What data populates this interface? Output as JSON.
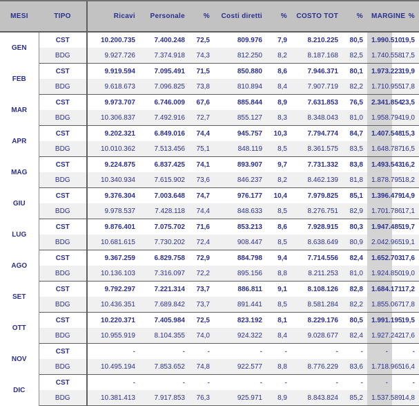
{
  "table": {
    "columns": [
      {
        "key": "mesi",
        "label": "MESI",
        "align": "center"
      },
      {
        "key": "tipo",
        "label": "TIPO",
        "align": "center"
      },
      {
        "key": "ricavi",
        "label": "Ricavi",
        "align": "right"
      },
      {
        "key": "personale",
        "label": "Personale",
        "align": "right"
      },
      {
        "key": "pct_pers",
        "label": "%",
        "align": "right"
      },
      {
        "key": "costi",
        "label": "Costi diretti",
        "align": "right"
      },
      {
        "key": "pct_costi",
        "label": "%",
        "align": "right"
      },
      {
        "key": "costotot",
        "label": "COSTO TOT",
        "align": "right"
      },
      {
        "key": "pct_tot",
        "label": "%",
        "align": "right"
      },
      {
        "key": "margine",
        "label": "MARGINE",
        "align": "right"
      },
      {
        "key": "pct_marg",
        "label": "%",
        "align": "right"
      }
    ],
    "colors": {
      "header_bg": "#c2c2c2",
      "header_text": "#2b2f8f",
      "body_text": "#2b2f8f",
      "row_cst_bg": "#ffffff",
      "row_bdg_bg": "#f0f0f0",
      "margine_highlight_bg": "#d4d4d4",
      "border_strong": "#5e5e5e",
      "border_light": "#8a8a8a"
    },
    "tipo_labels": {
      "cst": "CST",
      "bdg": "BDG"
    },
    "empty_value": "-",
    "months": [
      {
        "name": "GEN",
        "cst": {
          "tipo": "CST",
          "ricavi": "10.200.735",
          "personale": "7.400.248",
          "pct_pers": "72,5",
          "costi": "809.976",
          "pct_costi": "7,9",
          "costotot": "8.210.225",
          "pct_tot": "80,5",
          "margine": "1.990.510",
          "pct_marg": "19,5"
        },
        "bdg": {
          "tipo": "BDG",
          "ricavi": "9.927.726",
          "personale": "7.374.918",
          "pct_pers": "74,3",
          "costi": "812.250",
          "pct_costi": "8,2",
          "costotot": "8.187.168",
          "pct_tot": "82,5",
          "margine": "1.740.558",
          "pct_marg": "17,5"
        }
      },
      {
        "name": "FEB",
        "cst": {
          "tipo": "CST",
          "ricavi": "9.919.594",
          "personale": "7.095.491",
          "pct_pers": "71,5",
          "costi": "850.880",
          "pct_costi": "8,6",
          "costotot": "7.946.371",
          "pct_tot": "80,1",
          "margine": "1.973.223",
          "pct_marg": "19,9"
        },
        "bdg": {
          "tipo": "BDG",
          "ricavi": "9.618.673",
          "personale": "7.096.825",
          "pct_pers": "73,8",
          "costi": "810.894",
          "pct_costi": "8,4",
          "costotot": "7.907.719",
          "pct_tot": "82,2",
          "margine": "1.710.955",
          "pct_marg": "17,8"
        }
      },
      {
        "name": "MAR",
        "cst": {
          "tipo": "CST",
          "ricavi": "9.973.707",
          "personale": "6.746.009",
          "pct_pers": "67,6",
          "costi": "885.844",
          "pct_costi": "8,9",
          "costotot": "7.631.853",
          "pct_tot": "76,5",
          "margine": "2.341.854",
          "pct_marg": "23,5"
        },
        "bdg": {
          "tipo": "BDG",
          "ricavi": "10.306.837",
          "personale": "7.492.916",
          "pct_pers": "72,7",
          "costi": "855.127",
          "pct_costi": "8,3",
          "costotot": "8.348.043",
          "pct_tot": "81,0",
          "margine": "1.958.794",
          "pct_marg": "19,0"
        }
      },
      {
        "name": "APR",
        "cst": {
          "tipo": "CST",
          "ricavi": "9.202.321",
          "personale": "6.849.016",
          "pct_pers": "74,4",
          "costi": "945.757",
          "pct_costi": "10,3",
          "costotot": "7.794.774",
          "pct_tot": "84,7",
          "margine": "1.407.548",
          "pct_marg": "15,3"
        },
        "bdg": {
          "tipo": "BDG",
          "ricavi": "10.010.362",
          "personale": "7.513.456",
          "pct_pers": "75,1",
          "costi": "848.119",
          "pct_costi": "8,5",
          "costotot": "8.361.575",
          "pct_tot": "83,5",
          "margine": "1.648.787",
          "pct_marg": "16,5"
        }
      },
      {
        "name": "MAG",
        "cst": {
          "tipo": "CST",
          "ricavi": "9.224.875",
          "personale": "6.837.425",
          "pct_pers": "74,1",
          "costi": "893.907",
          "pct_costi": "9,7",
          "costotot": "7.731.332",
          "pct_tot": "83,8",
          "margine": "1.493.543",
          "pct_marg": "16,2"
        },
        "bdg": {
          "tipo": "BDG",
          "ricavi": "10.340.934",
          "personale": "7.615.902",
          "pct_pers": "73,6",
          "costi": "846.237",
          "pct_costi": "8,2",
          "costotot": "8.462.139",
          "pct_tot": "81,8",
          "margine": "1.878.795",
          "pct_marg": "18,2"
        }
      },
      {
        "name": "GIU",
        "cst": {
          "tipo": "CST",
          "ricavi": "9.376.304",
          "personale": "7.003.648",
          "pct_pers": "74,7",
          "costi": "976.177",
          "pct_costi": "10,4",
          "costotot": "7.979.825",
          "pct_tot": "85,1",
          "margine": "1.396.479",
          "pct_marg": "14,9"
        },
        "bdg": {
          "tipo": "BDG",
          "ricavi": "9.978.537",
          "personale": "7.428.118",
          "pct_pers": "74,4",
          "costi": "848.633",
          "pct_costi": "8,5",
          "costotot": "8.276.751",
          "pct_tot": "82,9",
          "margine": "1.701.786",
          "pct_marg": "17,1"
        }
      },
      {
        "name": "LUG",
        "cst": {
          "tipo": "CST",
          "ricavi": "9.876.401",
          "personale": "7.075.702",
          "pct_pers": "71,6",
          "costi": "853.213",
          "pct_costi": "8,6",
          "costotot": "7.928.915",
          "pct_tot": "80,3",
          "margine": "1.947.485",
          "pct_marg": "19,7"
        },
        "bdg": {
          "tipo": "BDG",
          "ricavi": "10.681.615",
          "personale": "7.730.202",
          "pct_pers": "72,4",
          "costi": "908.447",
          "pct_costi": "8,5",
          "costotot": "8.638.649",
          "pct_tot": "80,9",
          "margine": "2.042.965",
          "pct_marg": "19,1"
        }
      },
      {
        "name": "AGO",
        "cst": {
          "tipo": "CST",
          "ricavi": "9.367.259",
          "personale": "6.829.758",
          "pct_pers": "72,9",
          "costi": "884.798",
          "pct_costi": "9,4",
          "costotot": "7.714.556",
          "pct_tot": "82,4",
          "margine": "1.652.703",
          "pct_marg": "17,6"
        },
        "bdg": {
          "tipo": "BDG",
          "ricavi": "10.136.103",
          "personale": "7.316.097",
          "pct_pers": "72,2",
          "costi": "895.156",
          "pct_costi": "8,8",
          "costotot": "8.211.253",
          "pct_tot": "81,0",
          "margine": "1.924.850",
          "pct_marg": "19,0"
        }
      },
      {
        "name": "SET",
        "cst": {
          "tipo": "CST",
          "ricavi": "9.792.297",
          "personale": "7.221.314",
          "pct_pers": "73,7",
          "costi": "886.811",
          "pct_costi": "9,1",
          "costotot": "8.108.126",
          "pct_tot": "82,8",
          "margine": "1.684.171",
          "pct_marg": "17,2"
        },
        "bdg": {
          "tipo": "BDG",
          "ricavi": "10.436.351",
          "personale": "7.689.842",
          "pct_pers": "73,7",
          "costi": "891.441",
          "pct_costi": "8,5",
          "costotot": "8.581.284",
          "pct_tot": "82,2",
          "margine": "1.855.067",
          "pct_marg": "17,8"
        }
      },
      {
        "name": "OTT",
        "cst": {
          "tipo": "CST",
          "ricavi": "10.220.371",
          "personale": "7.405.984",
          "pct_pers": "72,5",
          "costi": "823.192",
          "pct_costi": "8,1",
          "costotot": "8.229.176",
          "pct_tot": "80,5",
          "margine": "1.991.195",
          "pct_marg": "19,5"
        },
        "bdg": {
          "tipo": "BDG",
          "ricavi": "10.955.919",
          "personale": "8.104.355",
          "pct_pers": "74,0",
          "costi": "924.322",
          "pct_costi": "8,4",
          "costotot": "9.028.677",
          "pct_tot": "82,4",
          "margine": "1.927.242",
          "pct_marg": "17,6"
        }
      },
      {
        "name": "NOV",
        "cst": {
          "tipo": "CST",
          "ricavi": "-",
          "personale": "-",
          "pct_pers": "-",
          "costi": "-",
          "pct_costi": "-",
          "costotot": "-",
          "pct_tot": "-",
          "margine": "-",
          "pct_marg": "-"
        },
        "bdg": {
          "tipo": "BDG",
          "ricavi": "10.495.194",
          "personale": "7.853.652",
          "pct_pers": "74,8",
          "costi": "922.577",
          "pct_costi": "8,8",
          "costotot": "8.776.229",
          "pct_tot": "83,6",
          "margine": "1.718.965",
          "pct_marg": "16,4"
        }
      },
      {
        "name": "DIC",
        "cst": {
          "tipo": "CST",
          "ricavi": "-",
          "personale": "-",
          "pct_pers": "-",
          "costi": "-",
          "pct_costi": "-",
          "costotot": "-",
          "pct_tot": "-",
          "margine": "-",
          "pct_marg": "-"
        },
        "bdg": {
          "tipo": "BDG",
          "ricavi": "10.381.413",
          "personale": "7.917.853",
          "pct_pers": "76,3",
          "costi": "925.971",
          "pct_costi": "8,9",
          "costotot": "8.843.824",
          "pct_tot": "85,2",
          "margine": "1.537.589",
          "pct_marg": "14,8"
        }
      }
    ]
  }
}
